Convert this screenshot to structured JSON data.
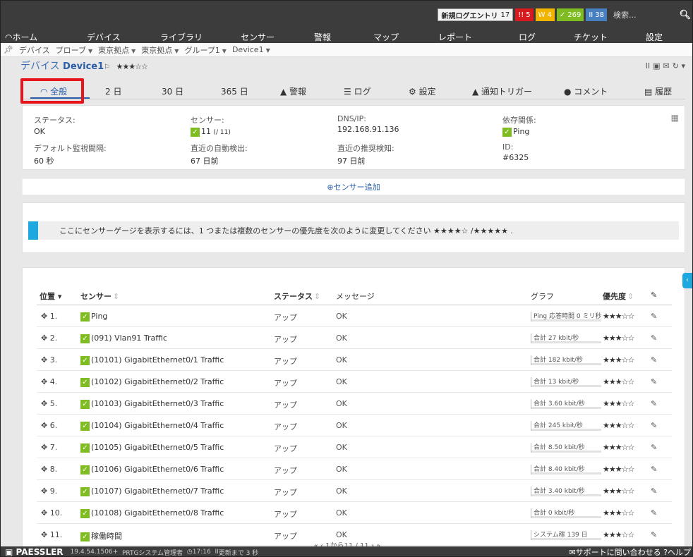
{
  "topbar": {
    "new_log_label": "新規ログエントリ",
    "new_log_count": "17",
    "badges": [
      {
        "icon": "!!",
        "count": "5",
        "color": "#d71920"
      },
      {
        "icon": "W",
        "count": "4",
        "color": "#f3b400"
      },
      {
        "icon": "✓",
        "count": "269",
        "color": "#7fbc21"
      },
      {
        "icon": "II",
        "count": "38",
        "color": "#477fc1"
      }
    ],
    "search_placeholder": "検索..."
  },
  "nav": {
    "items": [
      "ホーム",
      "デバイス",
      "ライブラリ",
      "センサー",
      "警報",
      "マップ",
      "レポート",
      "ログ",
      "チケット",
      "設定"
    ]
  },
  "breadcrumb": [
    "デバイス",
    "プローブ",
    "東京拠点",
    "東京拠点",
    "グループ1",
    "Device1"
  ],
  "device": {
    "type_label": "デバイス",
    "name": "Device1",
    "stars": "★★★☆☆"
  },
  "tabs": [
    "全般",
    "2 日",
    "30 日",
    "365 日",
    "警報",
    "ログ",
    "設定",
    "通知トリガー",
    "コメント",
    "履歴"
  ],
  "info": {
    "status_label": "ステータス:",
    "status_value": "OK",
    "sensors_label": "センサー:",
    "sensors_value": "11",
    "sensors_total": "(/ 11)",
    "dns_label": "DNS/IP:",
    "dns_value": "192.168.91.136",
    "dependency_label": "依存関係:",
    "dependency_value": "Ping",
    "interval_label": "デフォルト監視間隔:",
    "interval_value": "60 秒",
    "autodiscovery_label": "直近の自動検出:",
    "autodiscovery_value": "67 日前",
    "recommend_label": "直近の推奨検知:",
    "recommend_value": "97 日前",
    "id_label": "ID:",
    "id_value": "#6325"
  },
  "add_sensor_label": "センサー追加",
  "gauge_message": "ここにセンサーゲージを表示するには、1 つまたは複数のセンサーの優先度を次のように変更してください ★★★★☆ /★★★★★ .",
  "table": {
    "headers": {
      "position": "位置",
      "sensor": "センサー",
      "status": "ステータス",
      "message": "メッセージ",
      "graph": "グラフ",
      "priority": "優先度"
    },
    "rows": [
      {
        "pos": "1.",
        "name": "Ping",
        "status": "アップ",
        "message": "OK",
        "graph": "Ping 応答時間 0 ミリ秒",
        "priority": "★★★☆☆"
      },
      {
        "pos": "2.",
        "name": "(091) Vlan91 Traffic",
        "status": "アップ",
        "message": "OK",
        "graph": "合計 27 kbit/秒",
        "priority": "★★★☆☆"
      },
      {
        "pos": "3.",
        "name": "(10101) GigabitEthernet0/1 Traffic",
        "status": "アップ",
        "message": "OK",
        "graph": "合計 182 kbit/秒",
        "priority": "★★★☆☆"
      },
      {
        "pos": "4.",
        "name": "(10102) GigabitEthernet0/2 Traffic",
        "status": "アップ",
        "message": "OK",
        "graph": "合計 13 kbit/秒",
        "priority": "★★★☆☆"
      },
      {
        "pos": "5.",
        "name": "(10103) GigabitEthernet0/3 Traffic",
        "status": "アップ",
        "message": "OK",
        "graph": "合計 3.60 kbit/秒",
        "priority": "★★★☆☆"
      },
      {
        "pos": "6.",
        "name": "(10104) GigabitEthernet0/4 Traffic",
        "status": "アップ",
        "message": "OK",
        "graph": "合計 245 kbit/秒",
        "priority": "★★★☆☆"
      },
      {
        "pos": "7.",
        "name": "(10105) GigabitEthernet0/5 Traffic",
        "status": "アップ",
        "message": "OK",
        "graph": "合計 8.50 kbit/秒",
        "priority": "★★★☆☆"
      },
      {
        "pos": "8.",
        "name": "(10106) GigabitEthernet0/6 Traffic",
        "status": "アップ",
        "message": "OK",
        "graph": "合計 8.40 kbit/秒",
        "priority": "★★★☆☆"
      },
      {
        "pos": "9.",
        "name": "(10107) GigabitEthernet0/7 Traffic",
        "status": "アップ",
        "message": "OK",
        "graph": "合計 3.40 kbit/秒",
        "priority": "★★★☆☆"
      },
      {
        "pos": "10.",
        "name": "(10108) GigabitEthernet0/8 Traffic",
        "status": "アップ",
        "message": "OK",
        "graph": "合計 0 kbit/秒",
        "priority": "★★★☆☆"
      },
      {
        "pos": "11.",
        "name": "稼働時間",
        "status": "アップ",
        "message": "OK",
        "graph": "システム稼 139 日",
        "priority": "★★★☆☆"
      }
    ]
  },
  "pager": "1から11 / 11",
  "footer": {
    "brand": "PAESSLER",
    "version": "19.4.54.1506+",
    "user": "PRTGシステム管理者",
    "time": "17:16",
    "refresh": "更新まで 3 秒",
    "support": "サポートに問い合わせる",
    "help": "ヘルプ"
  }
}
